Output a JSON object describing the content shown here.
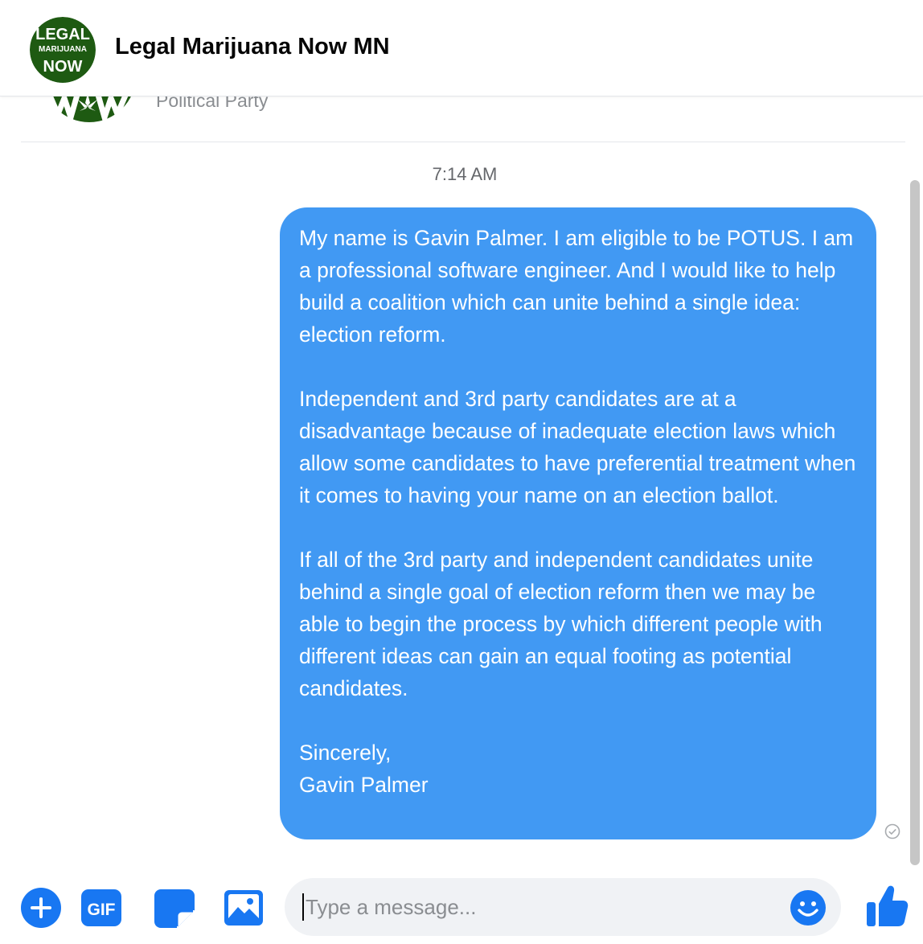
{
  "conversation": {
    "name": "Legal Marijuana Now MN",
    "subtitle": "Political Party",
    "logo_text": [
      "LEGAL",
      "MARIJUANA",
      "NOW"
    ]
  },
  "timestamp": "7:14 AM",
  "message": {
    "paragraphs": [
      "My name is Gavin Palmer.  I am eligible to be POTUS.  I am a professional software engineer.  And I would like to help build a coalition which can unite behind a single idea: election reform.",
      "Independent and 3rd party candidates are at a disadvantage because of inadequate election laws which allow some candidates to have preferential treatment when it comes to having your name on an election ballot.",
      "If all of the 3rd party and independent candidates unite behind a single goal of election reform then we may be able to begin the process by which different people with different ideas can gain an equal footing as potential candidates.",
      "Sincerely,\nGavin Palmer"
    ],
    "status": "sent"
  },
  "composer": {
    "placeholder": "Type a message...",
    "value": "",
    "gif_label": "GIF"
  },
  "colors": {
    "accent": "#1877f2",
    "bubble": "#4199f3",
    "logo_green": "#1e5a12"
  },
  "icons": [
    "plus-circle-icon",
    "gif-icon",
    "sticker-icon",
    "photo-icon",
    "emoji-icon",
    "thumbs-up-icon",
    "seen-check-icon"
  ]
}
